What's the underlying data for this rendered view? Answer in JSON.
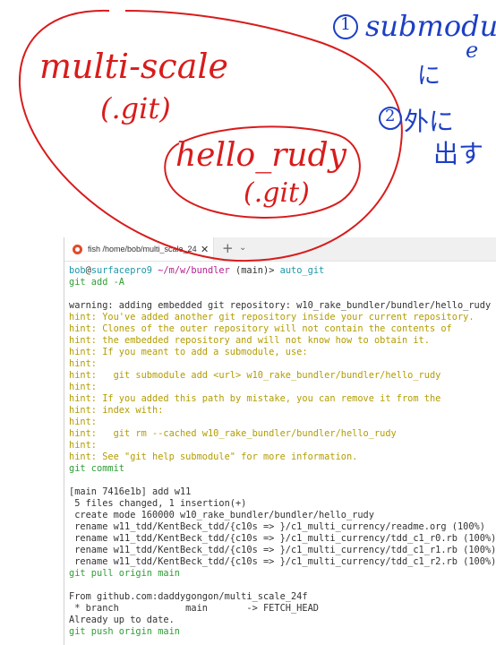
{
  "annotations": {
    "circled_one": "1",
    "circled_two": "2",
    "note_1a": "submodul",
    "note_1b": "e",
    "note_1c": "に",
    "note_2a": "外に",
    "note_2b": "出す",
    "outer_repo": "multi-scale",
    "outer_git": "(.git)",
    "inner_repo": "hello_rudy",
    "inner_git": "(.git)",
    "ink_colors": {
      "red": "#d81c1c",
      "blue": "#1d3fc4"
    }
  },
  "window": {
    "tab_title": "fish /home/bob/multi_scale_24",
    "tab_close": "✕",
    "new_tab": "+",
    "tab_menu": "⌄"
  },
  "terminal": {
    "prompt": {
      "user": "bob",
      "at": "@",
      "host": "surfacepro9",
      "path": " ~/m/w/bundler",
      "branch": " (main)",
      "symbol": "> ",
      "command": "auto_git"
    },
    "lines": [
      {
        "text": "git add -A",
        "style": "g"
      },
      {
        "text": "",
        "style": "n"
      },
      {
        "text": "warning: adding embedded git repository: w10_rake_bundler/bundler/hello_rudy",
        "style": "n"
      },
      {
        "text": "hint: You've added another git repository inside your current repository.",
        "style": "y"
      },
      {
        "text": "hint: Clones of the outer repository will not contain the contents of",
        "style": "y"
      },
      {
        "text": "hint: the embedded repository and will not know how to obtain it.",
        "style": "y"
      },
      {
        "text": "hint: If you meant to add a submodule, use:",
        "style": "y"
      },
      {
        "text": "hint:",
        "style": "y"
      },
      {
        "text": "hint:   git submodule add <url> w10_rake_bundler/bundler/hello_rudy",
        "style": "y"
      },
      {
        "text": "hint:",
        "style": "y"
      },
      {
        "text": "hint: If you added this path by mistake, you can remove it from the",
        "style": "y"
      },
      {
        "text": "hint: index with:",
        "style": "y"
      },
      {
        "text": "hint:",
        "style": "y"
      },
      {
        "text": "hint:   git rm --cached w10_rake_bundler/bundler/hello_rudy",
        "style": "y"
      },
      {
        "text": "hint:",
        "style": "y"
      },
      {
        "text": "hint: See \"git help submodule\" for more information.",
        "style": "y"
      },
      {
        "text": "git commit",
        "style": "g"
      },
      {
        "text": "",
        "style": "n"
      },
      {
        "text": "[main 7416e1b] add w11",
        "style": "n"
      },
      {
        "text": " 5 files changed, 1 insertion(+)",
        "style": "n"
      },
      {
        "text": " create mode 160000 w10_rake_bundler/bundler/hello_rudy",
        "style": "n"
      },
      {
        "text": " rename w11_tdd/KentBeck_tdd/{c10s => }/c1_multi_currency/readme.org (100%)",
        "style": "n"
      },
      {
        "text": " rename w11_tdd/KentBeck_tdd/{c10s => }/c1_multi_currency/tdd_c1_r0.rb (100%)",
        "style": "n"
      },
      {
        "text": " rename w11_tdd/KentBeck_tdd/{c10s => }/c1_multi_currency/tdd_c1_r1.rb (100%)",
        "style": "n"
      },
      {
        "text": " rename w11_tdd/KentBeck_tdd/{c10s => }/c1_multi_currency/tdd_c1_r2.rb (100%)",
        "style": "n"
      },
      {
        "text": "git pull origin main",
        "style": "g"
      },
      {
        "text": "",
        "style": "n"
      },
      {
        "text": "From github.com:daddygongon/multi_scale_24f",
        "style": "n"
      },
      {
        "text": " * branch            main       -> FETCH_HEAD",
        "style": "n"
      },
      {
        "text": "Already up to date.",
        "style": "n"
      },
      {
        "text": "git push origin main",
        "style": "g"
      }
    ]
  }
}
